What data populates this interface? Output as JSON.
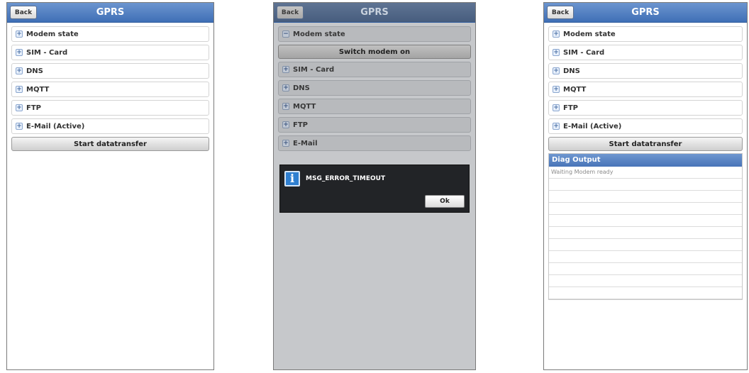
{
  "screens": [
    {
      "header": {
        "back": "Back",
        "title": "GPRS"
      },
      "rows": [
        {
          "label": "Modem state",
          "icon": "expand-plus-icon"
        },
        {
          "label": "SIM - Card",
          "icon": "expand-plus-icon"
        },
        {
          "label": "DNS",
          "icon": "expand-plus-icon"
        },
        {
          "label": "MQTT",
          "icon": "expand-plus-icon"
        },
        {
          "label": "FTP",
          "icon": "expand-plus-icon"
        },
        {
          "label": "E-Mail (Active)",
          "icon": "expand-plus-icon"
        }
      ],
      "button": "Start datatransfer"
    },
    {
      "header": {
        "back": "Back",
        "title": "GPRS"
      },
      "modem_row": {
        "label": "Modem state",
        "icon": "collapse-minus-icon",
        "symbol": "−"
      },
      "modem_button": "Switch modem on",
      "rows": [
        {
          "label": "SIM - Card"
        },
        {
          "label": "DNS"
        },
        {
          "label": "MQTT"
        },
        {
          "label": "FTP"
        },
        {
          "label": "E-Mail"
        }
      ],
      "dialog": {
        "icon": "info-icon",
        "message": "MSG_ERROR_TIMEOUT",
        "ok": "Ok"
      }
    },
    {
      "header": {
        "back": "Back",
        "title": "GPRS"
      },
      "rows": [
        {
          "label": "Modem state"
        },
        {
          "label": "SIM - Card"
        },
        {
          "label": "DNS"
        },
        {
          "label": "MQTT"
        },
        {
          "label": "FTP"
        },
        {
          "label": "E-Mail (Active)"
        }
      ],
      "button": "Start datatransfer",
      "diag": {
        "title": "Diag Output",
        "lines": [
          "Waiting Modem ready",
          "",
          "",
          "",
          "",
          "",
          "",
          "",
          "",
          "",
          ""
        ]
      }
    }
  ],
  "plus_symbol": "+",
  "colors": {
    "header_blue": "#4a78bb",
    "overlay_grey": "#c6c8cb",
    "dialog_dark": "#222427"
  }
}
